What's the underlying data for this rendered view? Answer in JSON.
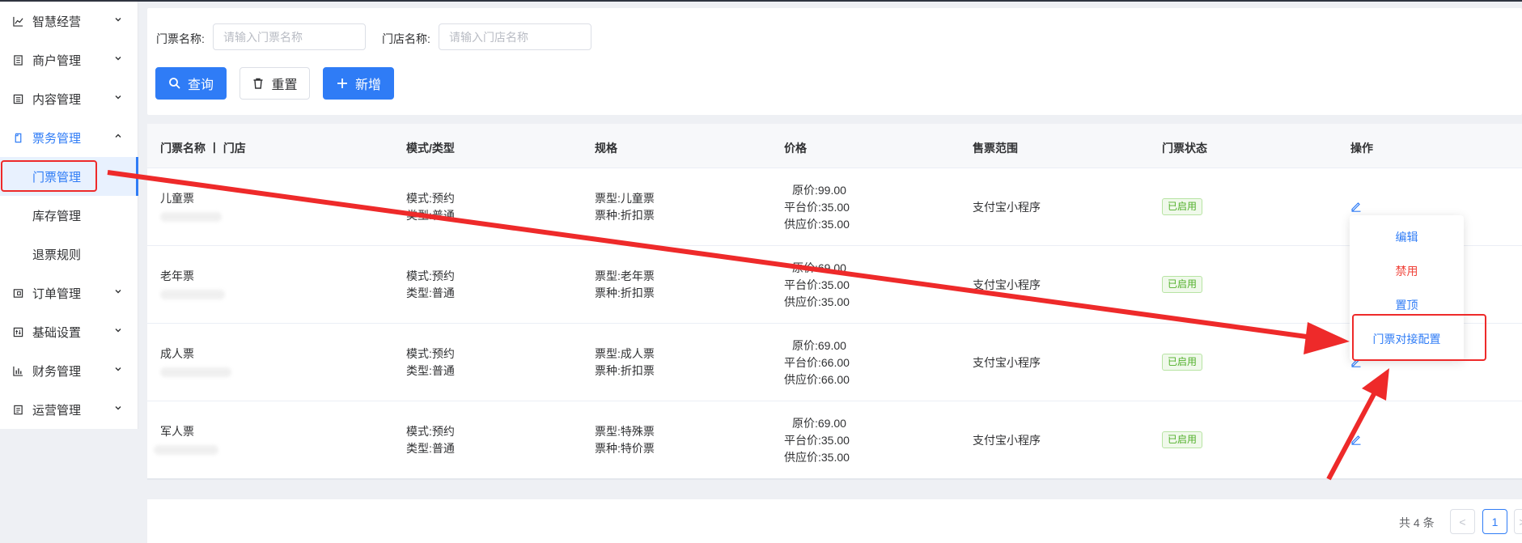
{
  "sidebar": {
    "items": [
      {
        "label": "智慧经营",
        "icon": "chart-line-icon"
      },
      {
        "label": "商户管理",
        "icon": "building-icon"
      },
      {
        "label": "内容管理",
        "icon": "document-icon"
      },
      {
        "label": "票务管理",
        "icon": "ticket-icon"
      },
      {
        "label": "订单管理",
        "icon": "order-icon"
      },
      {
        "label": "基础设置",
        "icon": "settings-icon"
      },
      {
        "label": "财务管理",
        "icon": "bar-chart-icon"
      },
      {
        "label": "运营管理",
        "icon": "clipboard-icon"
      }
    ],
    "sub_items": [
      {
        "label": "门票管理"
      },
      {
        "label": "库存管理"
      },
      {
        "label": "退票规则"
      }
    ]
  },
  "search": {
    "ticket_name_label": "门票名称:",
    "ticket_name_placeholder": "请输入门票名称",
    "store_name_label": "门店名称:",
    "store_name_placeholder": "请输入门店名称",
    "query_label": "查询",
    "reset_label": "重置",
    "add_label": "新增"
  },
  "table": {
    "headers": {
      "name": "门票名称 丨 门店",
      "mode": "模式/类型",
      "spec": "规格",
      "price": "价格",
      "scope": "售票范围",
      "status": "门票状态",
      "ops": "操作"
    },
    "rows": [
      {
        "name": "儿童票",
        "mode": "模式:预约",
        "type": "类型:普通",
        "ticket_type": "票型:儿童票",
        "ticket_kind": "票种:折扣票",
        "orig": "原价:99.00",
        "platform": "平台价:35.00",
        "supply": "供应价:35.00",
        "scope": "支付宝小程序",
        "status": "已启用"
      },
      {
        "name": "老年票",
        "mode": "模式:预约",
        "type": "类型:普通",
        "ticket_type": "票型:老年票",
        "ticket_kind": "票种:折扣票",
        "orig": "原价:69.00",
        "platform": "平台价:35.00",
        "supply": "供应价:35.00",
        "scope": "支付宝小程序",
        "status": "已启用"
      },
      {
        "name": "成人票",
        "mode": "模式:预约",
        "type": "类型:普通",
        "ticket_type": "票型:成人票",
        "ticket_kind": "票种:折扣票",
        "orig": "原价:69.00",
        "platform": "平台价:66.00",
        "supply": "供应价:66.00",
        "scope": "支付宝小程序",
        "status": "已启用"
      },
      {
        "name": "军人票",
        "mode": "模式:预约",
        "type": "类型:普通",
        "ticket_type": "票型:特殊票",
        "ticket_kind": "票种:特价票",
        "orig": "原价:69.00",
        "platform": "平台价:35.00",
        "supply": "供应价:35.00",
        "scope": "支付宝小程序",
        "status": "已启用"
      }
    ]
  },
  "dropdown": {
    "edit": "编辑",
    "disable": "禁用",
    "pin": "置顶",
    "config": "门票对接配置"
  },
  "pagination": {
    "total": "共 4 条",
    "current": "1",
    "prev": "<",
    "next": ">"
  },
  "colors": {
    "primary": "#2f7cf6",
    "annotation_red": "#ee2a2a",
    "danger": "#f0443b",
    "success": "#52b02b"
  }
}
